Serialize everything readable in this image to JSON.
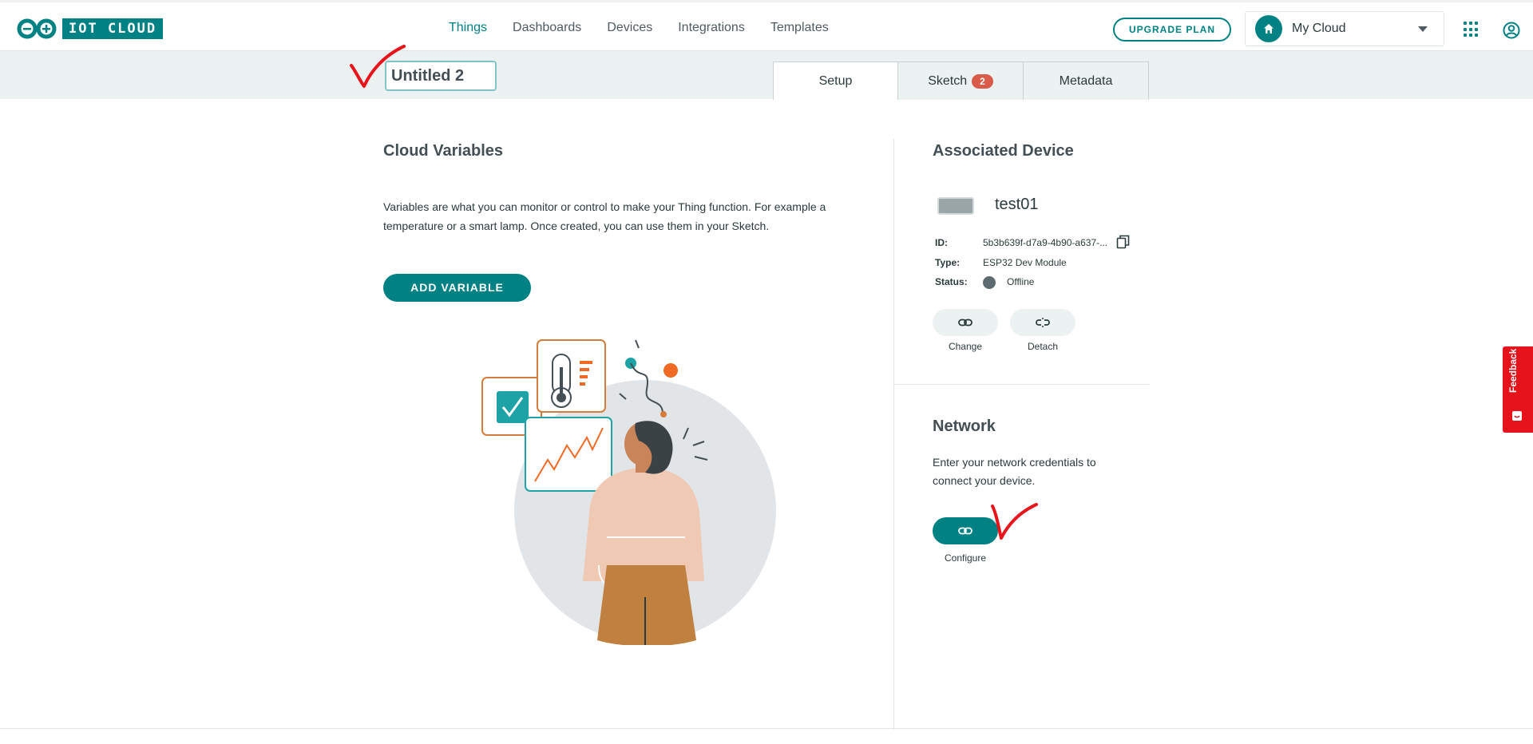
{
  "header": {
    "logo_text": "IOT CLOUD",
    "nav": [
      {
        "label": "Things",
        "active": true
      },
      {
        "label": "Dashboards",
        "active": false
      },
      {
        "label": "Devices",
        "active": false
      },
      {
        "label": "Integrations",
        "active": false
      },
      {
        "label": "Templates",
        "active": false
      }
    ],
    "upgrade_label": "UPGRADE PLAN",
    "space_name": "My Cloud"
  },
  "thing": {
    "name": "Untitled 2"
  },
  "tabs": [
    {
      "label": "Setup",
      "active": true
    },
    {
      "label": "Sketch",
      "badge": "2",
      "active": false
    },
    {
      "label": "Metadata",
      "active": false
    }
  ],
  "cloud_variables": {
    "title": "Cloud Variables",
    "description": "Variables are what you can monitor or control to make your Thing function. For example a temperature or a smart lamp. Once created, you can use them in your Sketch.",
    "add_label": "ADD VARIABLE"
  },
  "associated_device": {
    "title": "Associated Device",
    "device_name": "test01",
    "id_label": "ID:",
    "id_value": "5b3b639f-d7a9-4b90-a637-...",
    "type_label": "Type:",
    "type_value": "ESP32 Dev Module",
    "status_label": "Status:",
    "status_value": "Offline",
    "change_label": "Change",
    "detach_label": "Detach"
  },
  "network": {
    "title": "Network",
    "description": "Enter your network credentials to connect your device.",
    "configure_label": "Configure"
  },
  "feedback_label": "Feedback",
  "colors": {
    "accent": "#008184",
    "badge": "#da5b4a",
    "feedback": "#e7131a",
    "annotation": "#e8141c"
  }
}
